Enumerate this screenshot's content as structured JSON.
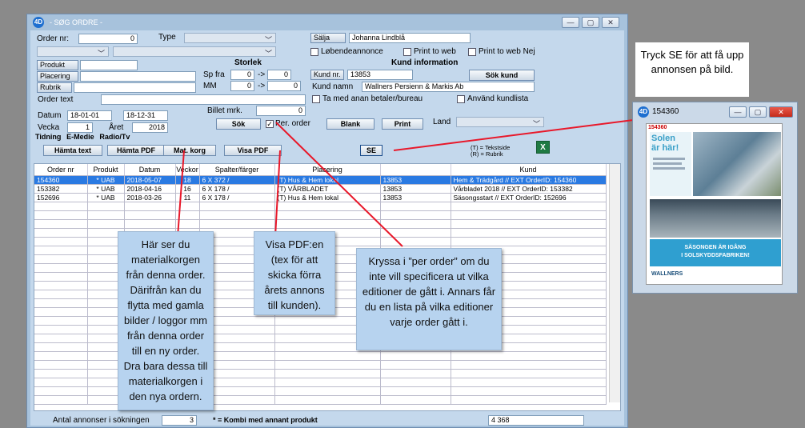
{
  "window": {
    "title": "- SØG ORDRE -",
    "controls": [
      "—",
      "▢",
      "✕"
    ]
  },
  "form": {
    "order_nr_label": "Order nr:",
    "order_nr_value": "0",
    "type_label": "Type",
    "salja_label": "Sälja",
    "salja_value": "Johanna Lindblå",
    "lobende_label": "Løbendeannonce",
    "print_to_web_label": "Print to web",
    "print_to_web_nej_label": "Print to web Nej",
    "produkt_label": "Produkt",
    "placering_label": "Placering",
    "rubrik_label": "Rubrik",
    "order_text_label": "Order text",
    "storlek_heading": "Storlek",
    "sp_fra_label": "Sp fra",
    "sp_fra_from": "0",
    "sp_fra_arrow": "->",
    "sp_fra_to": "0",
    "mm_label": "MM",
    "mm_from": "0",
    "mm_arrow": "->",
    "mm_to": "0",
    "kund_info_heading": "Kund information",
    "kund_nr_label": "Kund nr.",
    "kund_nr_value": "13853",
    "sok_kund_label": "Sök kund",
    "kund_namn_label": "Kund namn",
    "kund_namn_value": "Wallners Persienn & Markis Ab",
    "ta_med_label": "Ta med anan betaler/bureau",
    "anvand_label": "Använd kundlista",
    "datum_label": "Datum",
    "datum_from": "18-01-01",
    "datum_to": "18-12-31",
    "billet_label": "Billet mrk.",
    "billet_value": "0",
    "vecka_label": "Vecka",
    "vecka_value": "1",
    "aret_label": "Året",
    "aret_value": "2018",
    "sok_label": "Sök",
    "per_order_label": "Per. order",
    "per_order_check": "✓",
    "blank_label": "Blank",
    "print_label": "Print",
    "land_label": "Land"
  },
  "tabs": [
    "Tidning",
    "E-Medie",
    "Radio/Tv"
  ],
  "toolbar": {
    "hamta_text": "Hämta text",
    "hamta_pdf": "Hämta PDF",
    "mat_korg": "Mat. korg",
    "visa_pdf": "Visa PDF",
    "se": "SE",
    "legend_t": "(T) = Tekstside",
    "legend_r": "(R) = Rubrik",
    "excel": "X"
  },
  "table": {
    "columns": [
      "Order nr",
      "Produkt",
      "Datum",
      "Veckor",
      "Spalter/färger",
      "Placering",
      "",
      "Kund"
    ],
    "rows": [
      [
        "154360",
        "* UAB",
        "2018-05-07",
        "18",
        "6 X 372 /",
        "(T) Hus & Hem lokal",
        "13853",
        "Hem & Trädgård // EXT OrderID: 154360"
      ],
      [
        "153382",
        "* UAB",
        "2018-04-16",
        "16",
        "6 X 178 /",
        "(T) VÅRBLADET",
        "13853",
        "Vårbladet 2018 // EXT OrderID: 153382"
      ],
      [
        "152696",
        "* UAB",
        "2018-03-26",
        "11",
        "6 X 178 /",
        "(T) Hus & Hem lokal",
        "13853",
        "Säsongsstart // EXT OrderID: 152696"
      ]
    ]
  },
  "footer": {
    "antal_label": "Antal annonser i sökningen",
    "antal_value": "3",
    "kombi_label": "* = Kombi med annant produkt",
    "total_value": "4 368"
  },
  "callouts": {
    "se_hint": "Tryck SE för att få upp annonsen på bild.",
    "matkorg_hint": "Här ser du materialkorgen från denna order. Därifrån kan du flytta med gamla bilder / loggor mm från denna order till en ny order. Dra bara dessa till materialkorgen i den nya ordern.",
    "visapdf_hint": "Visa PDF:en (tex för att skicka förra årets annons till kunden).",
    "perorder_hint": "Kryssa i ”per order” om du inte vill specificera ut vilka editioner de gått i. Annars får du en lista på vilka editioner varje order gått i."
  },
  "image_window": {
    "title": "154360",
    "ad_id": "154360",
    "ad_headline_1": "Solen",
    "ad_headline_2": "är här!",
    "ad_banner_1": "SÄSONGEN ÄR IGÅNG",
    "ad_banner_2": "I SOLSKYDDSFABRIKEN!",
    "ad_logo": "WALLNERS"
  },
  "colors": {
    "window_bg": "#c4d8ec",
    "selected_row": "#2a7ae2",
    "callout_bg": "#b7d3ef",
    "arrow": "#e8182a"
  }
}
